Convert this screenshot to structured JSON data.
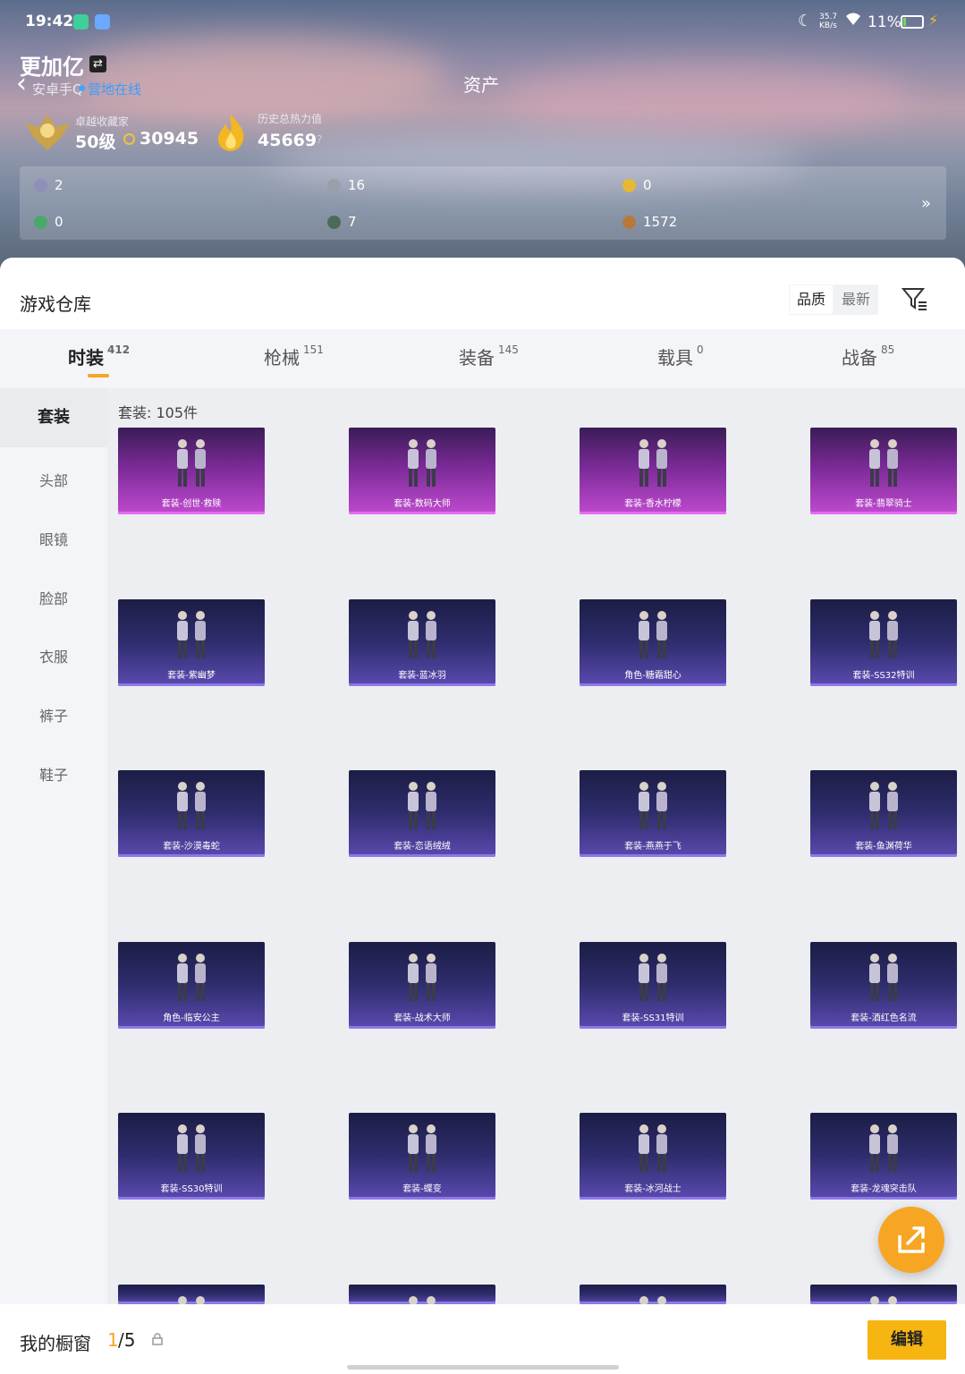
{
  "status": {
    "time": "19:42",
    "speed": "35.7\nKB/s",
    "battery": "11%"
  },
  "header": {
    "player_name": "更加亿",
    "platform": "安卓手Q",
    "online": "营地在线",
    "title": "资产",
    "rank_label": "卓越收藏家",
    "level": "50级",
    "coins": "30945",
    "heat_label": "历史总热力值",
    "heat_value": "45669",
    "help": "?"
  },
  "currencies": [
    {
      "icon": "ticket-icon",
      "value": "2",
      "color": "#8f8fb8"
    },
    {
      "icon": "silver-coin-icon",
      "value": "16",
      "color": "#9aa0aa"
    },
    {
      "icon": "gold-coin-icon",
      "value": "0",
      "color": "#e7b832"
    },
    {
      "icon": "green-gem-icon",
      "value": "0",
      "color": "#4aa86a"
    },
    {
      "icon": "dark-orb-icon",
      "value": "7",
      "color": "#4c6a58"
    },
    {
      "icon": "bronze-coin-icon",
      "value": "1572",
      "color": "#b8783a"
    }
  ],
  "warehouse": {
    "title": "游戏仓库",
    "sort_quality": "品质",
    "sort_newest": "最新"
  },
  "tabs": [
    {
      "label": "时装",
      "count": "412"
    },
    {
      "label": "枪械",
      "count": "151"
    },
    {
      "label": "装备",
      "count": "145"
    },
    {
      "label": "载具",
      "count": "0"
    },
    {
      "label": "战备",
      "count": "85"
    }
  ],
  "sidebar": [
    "套装",
    "头部",
    "眼镜",
    "脸部",
    "衣服",
    "裤子",
    "鞋子"
  ],
  "count_label": "套装: 105件",
  "items": [
    {
      "name": "套装-创世·救赎",
      "rarity": "legend"
    },
    {
      "name": "套装-数码大师",
      "rarity": "legend"
    },
    {
      "name": "套装-香水柠檬",
      "rarity": "legend"
    },
    {
      "name": "套装-翡翠骑士",
      "rarity": "legend"
    },
    {
      "name": "套装-紫幽梦",
      "rarity": "epic"
    },
    {
      "name": "套装-蓝冰羽",
      "rarity": "epic"
    },
    {
      "name": "角色-糖霜甜心",
      "rarity": "epic"
    },
    {
      "name": "套装-SS32特训",
      "rarity": "epic"
    },
    {
      "name": "套装-沙漠毒蛇",
      "rarity": "epic"
    },
    {
      "name": "套装-恋语绒绒",
      "rarity": "epic"
    },
    {
      "name": "套装-燕燕于飞",
      "rarity": "epic"
    },
    {
      "name": "套装-鱼渊荷华",
      "rarity": "epic"
    },
    {
      "name": "角色-临安公主",
      "rarity": "epic"
    },
    {
      "name": "套装-战术大师",
      "rarity": "epic"
    },
    {
      "name": "套装-SS31特训",
      "rarity": "epic"
    },
    {
      "name": "套装-酒红色名流",
      "rarity": "epic"
    },
    {
      "name": "套装-SS30特训",
      "rarity": "epic"
    },
    {
      "name": "套装-蝶变",
      "rarity": "epic"
    },
    {
      "name": "套装-冰河战士",
      "rarity": "epic"
    },
    {
      "name": "套装-龙魂突击队",
      "rarity": "epic"
    },
    {
      "name": "",
      "rarity": "epic"
    },
    {
      "name": "",
      "rarity": "epic"
    },
    {
      "name": "",
      "rarity": "epic"
    },
    {
      "name": "",
      "rarity": "epic"
    }
  ],
  "footer": {
    "showcase_label": "我的橱窗",
    "current": "1",
    "total": "/5",
    "edit": "编辑"
  }
}
